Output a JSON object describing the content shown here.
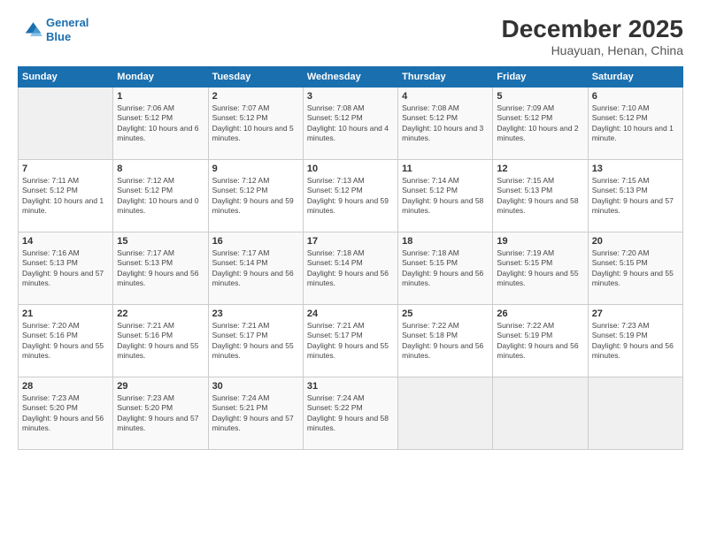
{
  "header": {
    "logo_line1": "General",
    "logo_line2": "Blue",
    "month": "December 2025",
    "location": "Huayuan, Henan, China"
  },
  "days_of_week": [
    "Sunday",
    "Monday",
    "Tuesday",
    "Wednesday",
    "Thursday",
    "Friday",
    "Saturday"
  ],
  "weeks": [
    [
      {
        "day": "",
        "empty": true
      },
      {
        "day": "1",
        "sunrise": "Sunrise: 7:06 AM",
        "sunset": "Sunset: 5:12 PM",
        "daylight": "Daylight: 10 hours and 6 minutes."
      },
      {
        "day": "2",
        "sunrise": "Sunrise: 7:07 AM",
        "sunset": "Sunset: 5:12 PM",
        "daylight": "Daylight: 10 hours and 5 minutes."
      },
      {
        "day": "3",
        "sunrise": "Sunrise: 7:08 AM",
        "sunset": "Sunset: 5:12 PM",
        "daylight": "Daylight: 10 hours and 4 minutes."
      },
      {
        "day": "4",
        "sunrise": "Sunrise: 7:08 AM",
        "sunset": "Sunset: 5:12 PM",
        "daylight": "Daylight: 10 hours and 3 minutes."
      },
      {
        "day": "5",
        "sunrise": "Sunrise: 7:09 AM",
        "sunset": "Sunset: 5:12 PM",
        "daylight": "Daylight: 10 hours and 2 minutes."
      },
      {
        "day": "6",
        "sunrise": "Sunrise: 7:10 AM",
        "sunset": "Sunset: 5:12 PM",
        "daylight": "Daylight: 10 hours and 1 minute."
      }
    ],
    [
      {
        "day": "7",
        "sunrise": "Sunrise: 7:11 AM",
        "sunset": "Sunset: 5:12 PM",
        "daylight": "Daylight: 10 hours and 1 minute."
      },
      {
        "day": "8",
        "sunrise": "Sunrise: 7:12 AM",
        "sunset": "Sunset: 5:12 PM",
        "daylight": "Daylight: 10 hours and 0 minutes."
      },
      {
        "day": "9",
        "sunrise": "Sunrise: 7:12 AM",
        "sunset": "Sunset: 5:12 PM",
        "daylight": "Daylight: 9 hours and 59 minutes."
      },
      {
        "day": "10",
        "sunrise": "Sunrise: 7:13 AM",
        "sunset": "Sunset: 5:12 PM",
        "daylight": "Daylight: 9 hours and 59 minutes."
      },
      {
        "day": "11",
        "sunrise": "Sunrise: 7:14 AM",
        "sunset": "Sunset: 5:12 PM",
        "daylight": "Daylight: 9 hours and 58 minutes."
      },
      {
        "day": "12",
        "sunrise": "Sunrise: 7:15 AM",
        "sunset": "Sunset: 5:13 PM",
        "daylight": "Daylight: 9 hours and 58 minutes."
      },
      {
        "day": "13",
        "sunrise": "Sunrise: 7:15 AM",
        "sunset": "Sunset: 5:13 PM",
        "daylight": "Daylight: 9 hours and 57 minutes."
      }
    ],
    [
      {
        "day": "14",
        "sunrise": "Sunrise: 7:16 AM",
        "sunset": "Sunset: 5:13 PM",
        "daylight": "Daylight: 9 hours and 57 minutes."
      },
      {
        "day": "15",
        "sunrise": "Sunrise: 7:17 AM",
        "sunset": "Sunset: 5:13 PM",
        "daylight": "Daylight: 9 hours and 56 minutes."
      },
      {
        "day": "16",
        "sunrise": "Sunrise: 7:17 AM",
        "sunset": "Sunset: 5:14 PM",
        "daylight": "Daylight: 9 hours and 56 minutes."
      },
      {
        "day": "17",
        "sunrise": "Sunrise: 7:18 AM",
        "sunset": "Sunset: 5:14 PM",
        "daylight": "Daylight: 9 hours and 56 minutes."
      },
      {
        "day": "18",
        "sunrise": "Sunrise: 7:18 AM",
        "sunset": "Sunset: 5:15 PM",
        "daylight": "Daylight: 9 hours and 56 minutes."
      },
      {
        "day": "19",
        "sunrise": "Sunrise: 7:19 AM",
        "sunset": "Sunset: 5:15 PM",
        "daylight": "Daylight: 9 hours and 55 minutes."
      },
      {
        "day": "20",
        "sunrise": "Sunrise: 7:20 AM",
        "sunset": "Sunset: 5:15 PM",
        "daylight": "Daylight: 9 hours and 55 minutes."
      }
    ],
    [
      {
        "day": "21",
        "sunrise": "Sunrise: 7:20 AM",
        "sunset": "Sunset: 5:16 PM",
        "daylight": "Daylight: 9 hours and 55 minutes."
      },
      {
        "day": "22",
        "sunrise": "Sunrise: 7:21 AM",
        "sunset": "Sunset: 5:16 PM",
        "daylight": "Daylight: 9 hours and 55 minutes."
      },
      {
        "day": "23",
        "sunrise": "Sunrise: 7:21 AM",
        "sunset": "Sunset: 5:17 PM",
        "daylight": "Daylight: 9 hours and 55 minutes."
      },
      {
        "day": "24",
        "sunrise": "Sunrise: 7:21 AM",
        "sunset": "Sunset: 5:17 PM",
        "daylight": "Daylight: 9 hours and 55 minutes."
      },
      {
        "day": "25",
        "sunrise": "Sunrise: 7:22 AM",
        "sunset": "Sunset: 5:18 PM",
        "daylight": "Daylight: 9 hours and 56 minutes."
      },
      {
        "day": "26",
        "sunrise": "Sunrise: 7:22 AM",
        "sunset": "Sunset: 5:19 PM",
        "daylight": "Daylight: 9 hours and 56 minutes."
      },
      {
        "day": "27",
        "sunrise": "Sunrise: 7:23 AM",
        "sunset": "Sunset: 5:19 PM",
        "daylight": "Daylight: 9 hours and 56 minutes."
      }
    ],
    [
      {
        "day": "28",
        "sunrise": "Sunrise: 7:23 AM",
        "sunset": "Sunset: 5:20 PM",
        "daylight": "Daylight: 9 hours and 56 minutes."
      },
      {
        "day": "29",
        "sunrise": "Sunrise: 7:23 AM",
        "sunset": "Sunset: 5:20 PM",
        "daylight": "Daylight: 9 hours and 57 minutes."
      },
      {
        "day": "30",
        "sunrise": "Sunrise: 7:24 AM",
        "sunset": "Sunset: 5:21 PM",
        "daylight": "Daylight: 9 hours and 57 minutes."
      },
      {
        "day": "31",
        "sunrise": "Sunrise: 7:24 AM",
        "sunset": "Sunset: 5:22 PM",
        "daylight": "Daylight: 9 hours and 58 minutes."
      },
      {
        "day": "",
        "empty": true
      },
      {
        "day": "",
        "empty": true
      },
      {
        "day": "",
        "empty": true
      }
    ]
  ]
}
